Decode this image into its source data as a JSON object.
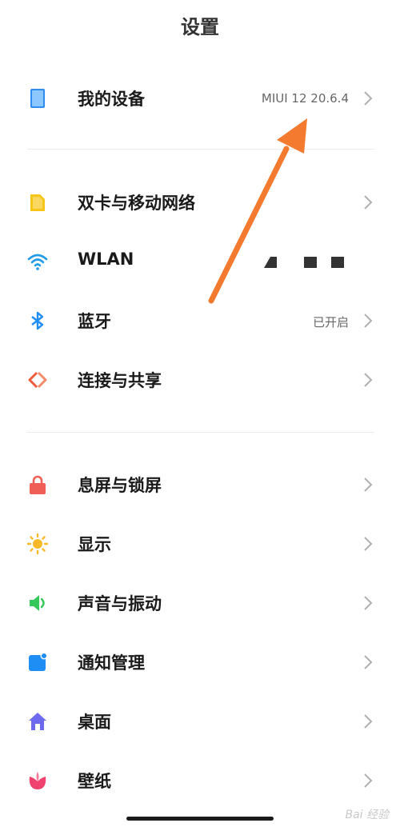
{
  "header": {
    "title": "设置"
  },
  "rows": [
    {
      "label": "我的设备",
      "value": "MIUI 12 20.6.4",
      "icon": "phone-icon",
      "color": "#2f8cf0"
    },
    {
      "label": "双卡与移动网络",
      "value": "",
      "icon": "sim-card-icon",
      "color": "#f5c518"
    },
    {
      "label": "WLAN",
      "value": "",
      "icon": "wifi-icon",
      "color": "#1e9be9"
    },
    {
      "label": "蓝牙",
      "value": "已开启",
      "icon": "bluetooth-icon",
      "color": "#1e8ef5"
    },
    {
      "label": "连接与共享",
      "value": "",
      "icon": "connection-share-icon",
      "color": "#ef5a3c"
    },
    {
      "label": "息屏与锁屏",
      "value": "",
      "icon": "lock-icon",
      "color": "#f05f55"
    },
    {
      "label": "显示",
      "value": "",
      "icon": "sun-icon",
      "color": "#f7b928"
    },
    {
      "label": "声音与振动",
      "value": "",
      "icon": "speaker-icon",
      "color": "#34c759"
    },
    {
      "label": "通知管理",
      "value": "",
      "icon": "notification-icon",
      "color": "#1e8ef5"
    },
    {
      "label": "桌面",
      "value": "",
      "icon": "home-icon",
      "color": "#6e6af0"
    },
    {
      "label": "壁纸",
      "value": "",
      "icon": "flower-icon",
      "color": "#f0426e"
    }
  ],
  "watermark": "Bai 经验",
  "accent_color": "#f47a30"
}
